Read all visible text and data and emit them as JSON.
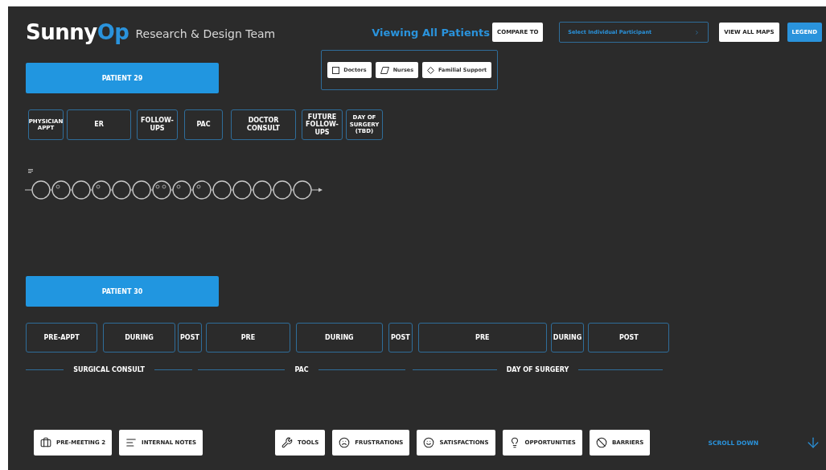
{
  "header": {
    "logo": {
      "first": "Sunny",
      "second": "Op"
    },
    "team": "Research & Design Team",
    "viewing": "Viewing All Patients",
    "compare_button": "COMPARE TO",
    "compare_options": [
      {
        "label": "Doctors",
        "kind": "square"
      },
      {
        "label": "Nurses",
        "kind": "parallelogram"
      },
      {
        "label": "Familial Support",
        "kind": "diamond"
      }
    ],
    "participant_select": {
      "placeholder": "Select Individual Participant"
    },
    "view_all_button": "VIEW ALL MAPS",
    "legend_button": "LEGEND"
  },
  "patients": [
    {
      "title": "PATIENT 29",
      "phases": [
        {
          "label": "PHYSICIAN APPT",
          "kind": "tiny"
        },
        {
          "label": "ER",
          "kind": "normal"
        },
        {
          "label": "FOLLOW-UPS",
          "kind": "normal"
        },
        {
          "label": "PAC",
          "kind": "normal"
        },
        {
          "label": "DOCTOR CONSULT",
          "kind": "normal"
        },
        {
          "label": "FUTURE FOLLOW-UPS",
          "kind": "normal"
        },
        {
          "label": "DAY OF SURGERY (TBD)",
          "kind": "tiny"
        }
      ],
      "timeline": [
        {
          "kind": "plain"
        },
        {
          "kind": "one-mark"
        },
        {
          "kind": "plain"
        },
        {
          "kind": "one-mark"
        },
        {
          "kind": "plain"
        },
        {
          "kind": "plain"
        },
        {
          "kind": "two-marks"
        },
        {
          "kind": "one-mark"
        },
        {
          "kind": "one-mark"
        },
        {
          "kind": "plain"
        },
        {
          "kind": "plain"
        },
        {
          "kind": "plain"
        },
        {
          "kind": "plain"
        },
        {
          "kind": "plain"
        }
      ]
    },
    {
      "title": "PATIENT 30",
      "phases": [
        {
          "label": "PRE-APPT",
          "kind": "normal"
        },
        {
          "label": "DURING",
          "kind": "normal"
        },
        {
          "label": "POST",
          "kind": "normal"
        },
        {
          "label": "PRE",
          "kind": "normal"
        },
        {
          "label": "DURING",
          "kind": "normal"
        },
        {
          "label": "POST",
          "kind": "normal"
        },
        {
          "label": "PRE",
          "kind": "normal"
        },
        {
          "label": "DURING",
          "kind": "normal"
        },
        {
          "label": "POST",
          "kind": "normal"
        }
      ],
      "sections": [
        "SURGICAL CONSULT",
        "PAC",
        "DAY OF SURGERY"
      ]
    }
  ],
  "toolbar": {
    "left": [
      {
        "label": "PRE-MEETING 2",
        "kind": "briefcase"
      },
      {
        "label": "INTERNAL NOTES",
        "kind": "lines"
      }
    ],
    "filters": [
      {
        "label": "TOOLS",
        "kind": "wrench"
      },
      {
        "label": "FRUSTRATIONS",
        "kind": "frown"
      },
      {
        "label": "SATISFACTIONS",
        "kind": "smile"
      },
      {
        "label": "OPPORTUNITIES",
        "kind": "bulb"
      },
      {
        "label": "BARRIERS",
        "kind": "ban"
      }
    ],
    "scroll": "SCROLL DOWN"
  }
}
